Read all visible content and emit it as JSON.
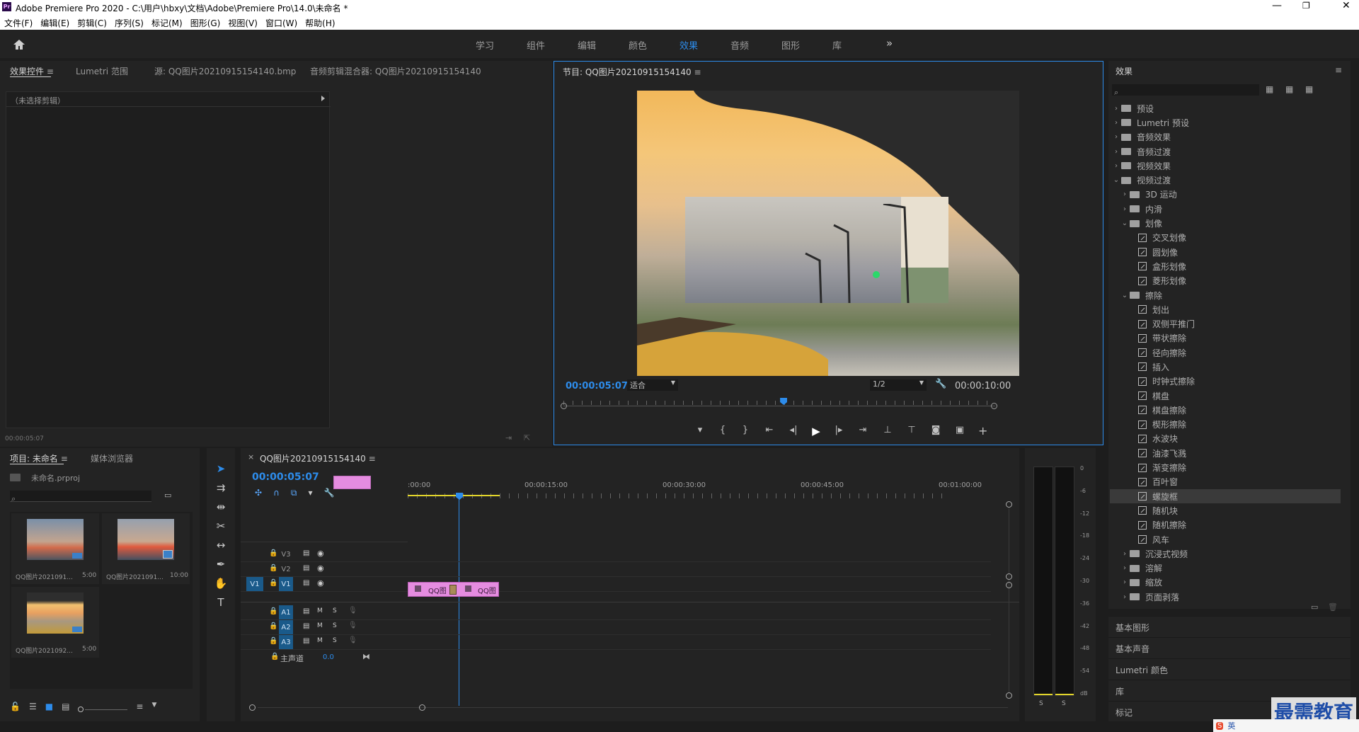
{
  "app": {
    "title": "Adobe Premiere Pro 2020 - C:\\用户\\hbxy\\文档\\Adobe\\Premiere Pro\\14.0\\未命名 *",
    "logo": "Pr"
  },
  "menu": [
    "文件(F)",
    "编辑(E)",
    "剪辑(C)",
    "序列(S)",
    "标记(M)",
    "图形(G)",
    "视图(V)",
    "窗口(W)",
    "帮助(H)"
  ],
  "workspaces": {
    "items": [
      "学习",
      "组件",
      "编辑",
      "颜色",
      "效果",
      "音频",
      "图形",
      "库"
    ],
    "active": "效果",
    "more": "»"
  },
  "source_panel": {
    "tabs": [
      "效果控件",
      "Lumetri 范围",
      "源: QQ图片20210915154140.bmp",
      "音频剪辑混合器: QQ图片20210915154140"
    ],
    "no_clip": "（未选择剪辑）",
    "timecode": "00:00:05:07"
  },
  "program_monitor": {
    "title": "节目: QQ图片20210915154140",
    "timecode": "00:00:05:07",
    "fit": "适合",
    "resolution": "1/2",
    "duration": "00:00:10:00",
    "playhead_fraction": 0.51
  },
  "project_panel": {
    "tabs": [
      "项目: 未命名",
      "媒体浏览器"
    ],
    "file": "未命名.prproj",
    "items": [
      {
        "name": "QQ图片2021091...",
        "duration": "5:00"
      },
      {
        "name": "QQ图片2021091...",
        "duration": "10:00"
      },
      {
        "name": "QQ图片2021092...",
        "duration": "5:00"
      }
    ]
  },
  "timeline": {
    "sequence": "QQ图片20210915154140",
    "timecode": "00:00:05:07",
    "ruler": [
      ":00:00",
      "00:00:15:00",
      "00:00:30:00",
      "00:00:45:00",
      "00:01:00:00"
    ],
    "video_tracks": [
      "V3",
      "V2",
      "V1"
    ],
    "audio_tracks": [
      "A1",
      "A2",
      "A3"
    ],
    "source_patch": "V1",
    "master": {
      "label": "主声道",
      "value": "0.0"
    },
    "clips": [
      {
        "label": "QQ图"
      },
      {
        "label": "QQ图"
      }
    ],
    "mute": "M",
    "solo": "S"
  },
  "meter": {
    "scale": [
      "0",
      "-6",
      "-12",
      "-18",
      "-24",
      "-30",
      "-36",
      "-42",
      "-48",
      "-54",
      "dB"
    ],
    "solo": [
      "S",
      "S"
    ]
  },
  "effects_panel": {
    "title": "效果",
    "tree": [
      {
        "label": "预设",
        "level": 0,
        "type": "folder",
        "open": false
      },
      {
        "label": "Lumetri 预设",
        "level": 0,
        "type": "folder",
        "open": false
      },
      {
        "label": "音频效果",
        "level": 0,
        "type": "folder",
        "open": false
      },
      {
        "label": "音频过渡",
        "level": 0,
        "type": "folder",
        "open": false
      },
      {
        "label": "视频效果",
        "level": 0,
        "type": "folder",
        "open": false
      },
      {
        "label": "视频过渡",
        "level": 0,
        "type": "folder",
        "open": true
      },
      {
        "label": "3D 运动",
        "level": 1,
        "type": "folder",
        "open": false
      },
      {
        "label": "内滑",
        "level": 1,
        "type": "folder",
        "open": false
      },
      {
        "label": "划像",
        "level": 1,
        "type": "folder",
        "open": true
      },
      {
        "label": "交叉划像",
        "level": 2,
        "type": "fx"
      },
      {
        "label": "圆划像",
        "level": 2,
        "type": "fx"
      },
      {
        "label": "盒形划像",
        "level": 2,
        "type": "fx"
      },
      {
        "label": "菱形划像",
        "level": 2,
        "type": "fx"
      },
      {
        "label": "擦除",
        "level": 1,
        "type": "folder",
        "open": true
      },
      {
        "label": "划出",
        "level": 2,
        "type": "fx"
      },
      {
        "label": "双侧平推门",
        "level": 2,
        "type": "fx"
      },
      {
        "label": "带状擦除",
        "level": 2,
        "type": "fx"
      },
      {
        "label": "径向擦除",
        "level": 2,
        "type": "fx"
      },
      {
        "label": "插入",
        "level": 2,
        "type": "fx"
      },
      {
        "label": "时钟式擦除",
        "level": 2,
        "type": "fx"
      },
      {
        "label": "棋盘",
        "level": 2,
        "type": "fx"
      },
      {
        "label": "棋盘擦除",
        "level": 2,
        "type": "fx"
      },
      {
        "label": "楔形擦除",
        "level": 2,
        "type": "fx"
      },
      {
        "label": "水波块",
        "level": 2,
        "type": "fx"
      },
      {
        "label": "油漆飞溅",
        "level": 2,
        "type": "fx"
      },
      {
        "label": "渐变擦除",
        "level": 2,
        "type": "fx"
      },
      {
        "label": "百叶窗",
        "level": 2,
        "type": "fx"
      },
      {
        "label": "螺旋框",
        "level": 2,
        "type": "fx",
        "selected": true
      },
      {
        "label": "随机块",
        "level": 2,
        "type": "fx"
      },
      {
        "label": "随机擦除",
        "level": 2,
        "type": "fx"
      },
      {
        "label": "风车",
        "level": 2,
        "type": "fx"
      },
      {
        "label": "沉浸式视频",
        "level": 1,
        "type": "folder",
        "open": false
      },
      {
        "label": "溶解",
        "level": 1,
        "type": "folder",
        "open": false
      },
      {
        "label": "缩放",
        "level": 1,
        "type": "folder",
        "open": false
      },
      {
        "label": "页面剥落",
        "level": 1,
        "type": "folder",
        "open": false
      }
    ],
    "collapsed": [
      "基本图形",
      "基本声音",
      "Lumetri 颜色",
      "库",
      "标记"
    ]
  },
  "watermark": "最需教育",
  "taskbar": {
    "ime": "英"
  },
  "colors": {
    "accent": "#2d8ceb",
    "clip": "#e58ce0",
    "bg": "#232323"
  }
}
